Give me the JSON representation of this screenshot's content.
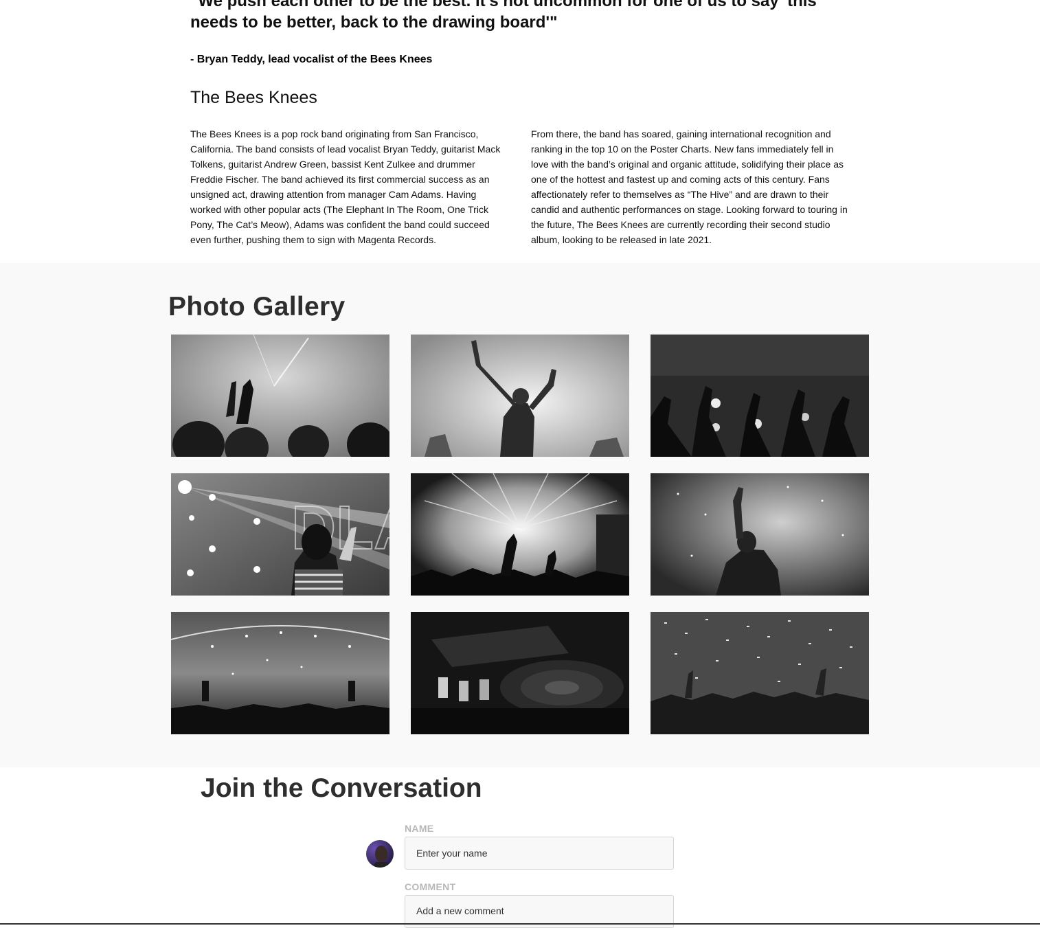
{
  "quote": {
    "text": "\"We push each other to be the best. It's not uncommon for one of us to say 'this needs to be better, back to the drawing board'\"",
    "attribution": "- Bryan Teddy, lead vocalist of the Bees Knees"
  },
  "band": {
    "title": "The Bees Knees",
    "bio_left": "The Bees Knees is a pop rock band originating from San Francisco, California. The band consists of lead vocalist Bryan Teddy, guitarist Mack Tolkens, guitarist Andrew Green, bassist Kent Zulkee and drummer Freddie Fischer. The band achieved its first commercial success as an unsigned act, drawing attention from manager Cam Adams. Having worked with other popular acts (The Elephant In The Room, One Trick Pony, The Cat’s Meow), Adams was confident the band could succeed even further, pushing them to sign with Magenta Records.",
    "bio_right": "From there, the band has soared, gaining international recognition and ranking in the top 10 on the Poster Charts. New fans immediately fell in love with the band’s original and organic attitude, solidifying their place as one of the hottest and fastest up and coming acts of this century. Fans affectionately refer to themselves as “The Hive” and are drawn to their candid and authentic performances on stage. Looking forward to touring in the future, The Bees Knees are currently recording their second studio album, looking to be released in late 2021."
  },
  "gallery": {
    "title": "Photo Gallery",
    "photos": [
      "concert-crowd-hands-smoke-photo",
      "woman-arms-raised-festival-photo",
      "silhouette-hands-stage-lights-photo",
      "woman-waving-stage-lights-photo",
      "fireworks-crowd-stage-photo",
      "man-hand-raised-smoke-photo",
      "arena-crowd-confetti-photo",
      "dj-turntable-mixer-photo",
      "confetti-crowd-celebration-photo"
    ]
  },
  "conversation": {
    "title": "Join the Conversation",
    "name_label": "NAME",
    "name_placeholder": "Enter your name",
    "comment_label": "COMMENT",
    "comment_placeholder": "Add a new comment"
  }
}
